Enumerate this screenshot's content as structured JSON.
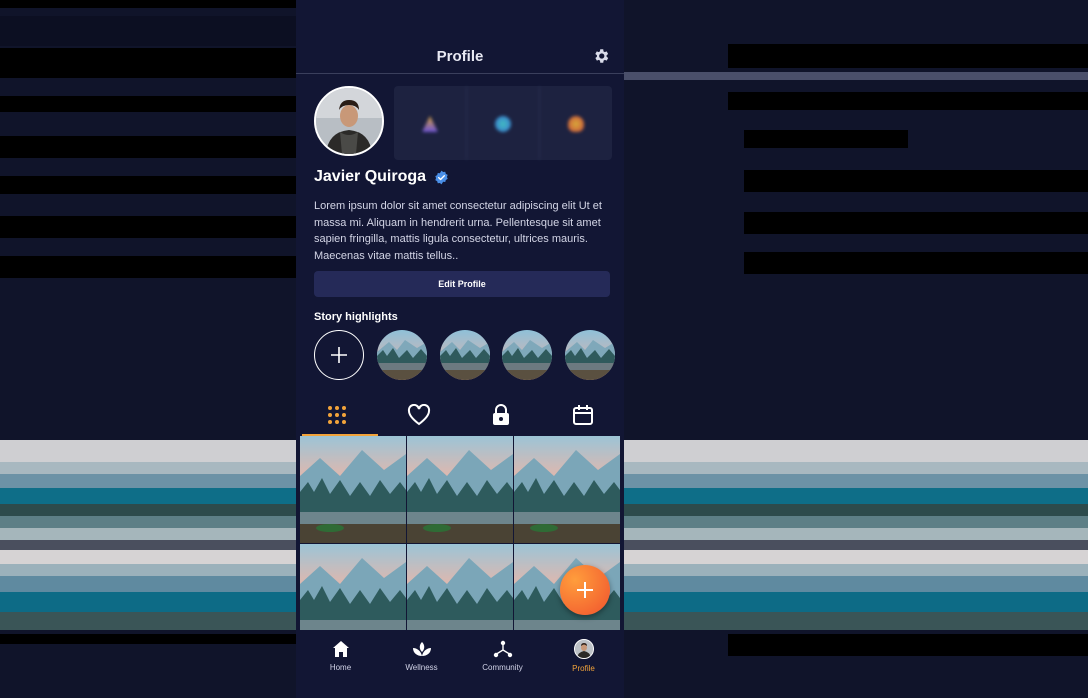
{
  "header": {
    "title": "Profile",
    "settings_icon": "gear-icon"
  },
  "profile": {
    "name": "Javier Quiroga",
    "verified_icon": "verified-badge-icon",
    "bio": "Lorem ipsum dolor sit amet consectetur adipiscing elit Ut et massa mi. Aliquam in hendrerit urna. Pellentesque sit amet sapien fringilla, mattis ligula consectetur, ultrices mauris. Maecenas vitae mattis tellus..",
    "edit_button": "Edit Profile"
  },
  "highlights": {
    "title": "Story highlights",
    "add_icon": "plus-icon"
  },
  "tabs": [
    {
      "icon": "grid-dots-icon",
      "active": true
    },
    {
      "icon": "heart-icon",
      "active": false
    },
    {
      "icon": "lock-icon",
      "active": false
    },
    {
      "icon": "calendar-icon",
      "active": false
    }
  ],
  "fab": {
    "icon": "plus-icon"
  },
  "nav": [
    {
      "label": "Home",
      "icon": "home-icon"
    },
    {
      "label": "Wellness",
      "icon": "lotus-icon"
    },
    {
      "label": "Community",
      "icon": "community-icon"
    },
    {
      "label": "Profile",
      "icon": "avatar-icon",
      "active": true
    }
  ],
  "colors": {
    "accent": "#f2a33a",
    "background": "#121634",
    "button": "#252a58",
    "verified": "#4a8fe7"
  }
}
